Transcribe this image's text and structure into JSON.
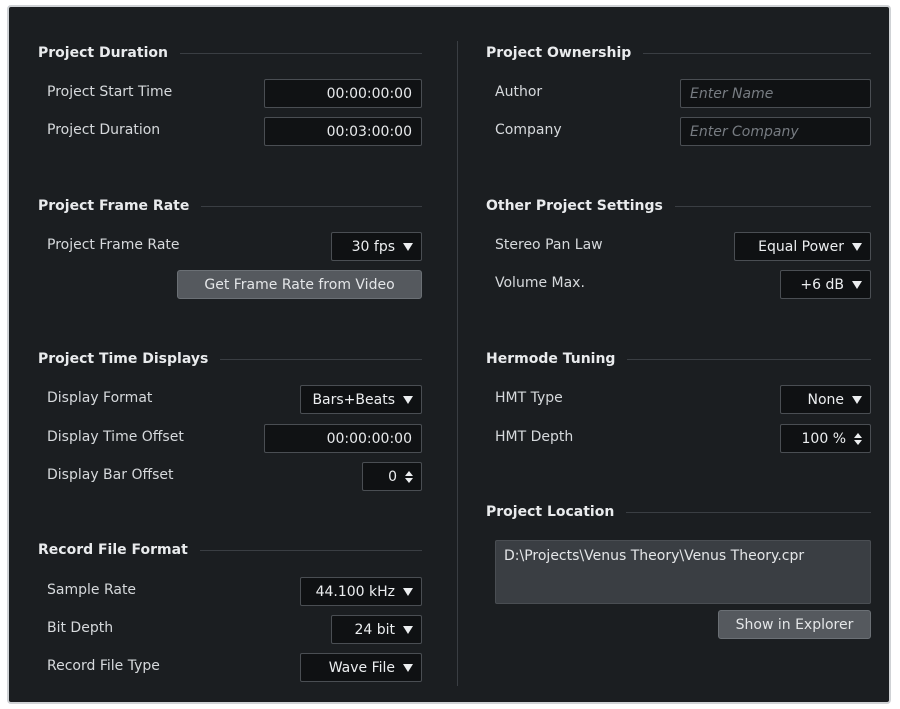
{
  "project_duration": {
    "title": "Project Duration",
    "start_time_label": "Project Start Time",
    "start_time_value": "00:00:00:00",
    "duration_label": "Project Duration",
    "duration_value": "00:03:00:00"
  },
  "project_ownership": {
    "title": "Project Ownership",
    "author_label": "Author",
    "author_placeholder": "Enter Name",
    "company_label": "Company",
    "company_placeholder": "Enter Company"
  },
  "project_frame_rate": {
    "title": "Project Frame Rate",
    "frame_rate_label": "Project Frame Rate",
    "frame_rate_value": "30 fps",
    "get_from_video_button": "Get Frame Rate from Video"
  },
  "other_project_settings": {
    "title": "Other Project Settings",
    "pan_law_label": "Stereo Pan Law",
    "pan_law_value": "Equal Power",
    "volume_max_label": "Volume Max.",
    "volume_max_value": "+6 dB"
  },
  "project_time_displays": {
    "title": "Project Time Displays",
    "display_format_label": "Display Format",
    "display_format_value": "Bars+Beats",
    "time_offset_label": "Display Time Offset",
    "time_offset_value": "00:00:00:00",
    "bar_offset_label": "Display Bar Offset",
    "bar_offset_value": "0"
  },
  "hermode_tuning": {
    "title": "Hermode Tuning",
    "hmt_type_label": "HMT Type",
    "hmt_type_value": "None",
    "hmt_depth_label": "HMT Depth",
    "hmt_depth_value": "100 %"
  },
  "record_file_format": {
    "title": "Record File Format",
    "sample_rate_label": "Sample Rate",
    "sample_rate_value": "44.100 kHz",
    "bit_depth_label": "Bit Depth",
    "bit_depth_value": "24 bit",
    "file_type_label": "Record File Type",
    "file_type_value": "Wave File"
  },
  "project_location": {
    "title": "Project Location",
    "path": "D:\\Projects\\Venus Theory\\Venus Theory.cpr",
    "show_in_explorer_button": "Show in Explorer"
  },
  "icons": {
    "dropdown": "triangle-down-icon",
    "spinner": "up-down-stepper-icon"
  },
  "colors": {
    "panel_background": "#1b1e21",
    "field_background": "#101214",
    "button_background": "#55595e",
    "text": "#d6d9dc"
  }
}
